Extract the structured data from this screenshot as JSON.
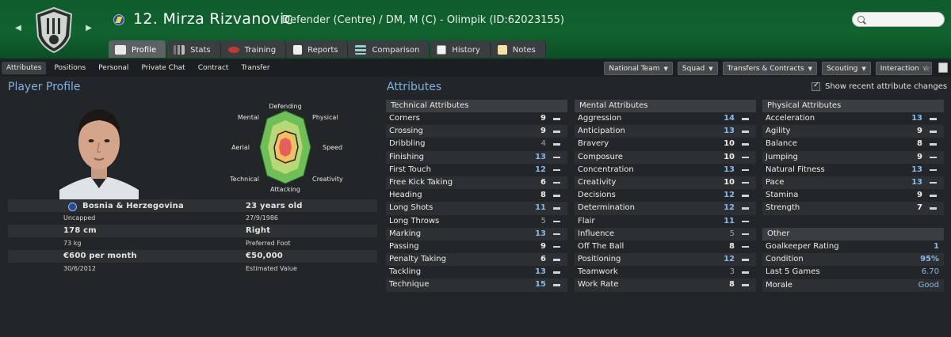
{
  "header": {
    "player_title": "12. Mirza Rizvanovic",
    "player_subtitle": "Defender (Centre) / DM, M (C) - Olimpik (ID:62023155)",
    "search_placeholder": "",
    "accent_color": "#10632f"
  },
  "tabs": [
    {
      "label": "Profile",
      "active": true
    },
    {
      "label": "Stats"
    },
    {
      "label": "Training"
    },
    {
      "label": "Reports"
    },
    {
      "label": "Comparison"
    },
    {
      "label": "History"
    },
    {
      "label": "Notes"
    }
  ],
  "subnav": {
    "links": [
      "Attributes",
      "Positions",
      "Personal",
      "Private Chat",
      "Contract",
      "Transfer"
    ],
    "buttons": [
      "National Team",
      "Squad",
      "Transfers & Contracts",
      "Scouting",
      "Interaction"
    ]
  },
  "profile": {
    "title": "Player Profile",
    "radar_labels": {
      "top": "Defending",
      "top_right": "Physical",
      "right": "Speed",
      "bottom_right": "Creativity",
      "bottom": "Attacking",
      "bottom_left": "Technical",
      "left": "Aerial",
      "top_left": "Mental"
    },
    "nationality": "Bosnia & Herzegovina",
    "caps": "Uncapped",
    "height": "178 cm",
    "weight": "73 kg",
    "wage": "€600 per month",
    "contract_end": "30/6/2012",
    "age": "23 years old",
    "dob": "27/9/1986",
    "foot": "Right",
    "foot_label": "Preferred Foot",
    "value": "€50,000",
    "value_label": "Estimated Value"
  },
  "attributes": {
    "title": "Attributes",
    "show_recent_label": "Show recent attribute changes",
    "technical": {
      "header": "Technical Attributes",
      "rows": [
        {
          "name": "Corners",
          "value": "9"
        },
        {
          "name": "Crossing",
          "value": "9"
        },
        {
          "name": "Dribbling",
          "value": "4"
        },
        {
          "name": "Finishing",
          "value": "13"
        },
        {
          "name": "First Touch",
          "value": "12"
        },
        {
          "name": "Free Kick Taking",
          "value": "6"
        },
        {
          "name": "Heading",
          "value": "8"
        },
        {
          "name": "Long Shots",
          "value": "11"
        },
        {
          "name": "Long Throws",
          "value": "5"
        },
        {
          "name": "Marking",
          "value": "13"
        },
        {
          "name": "Passing",
          "value": "9"
        },
        {
          "name": "Penalty Taking",
          "value": "6"
        },
        {
          "name": "Tackling",
          "value": "13"
        },
        {
          "name": "Technique",
          "value": "15"
        }
      ]
    },
    "mental": {
      "header": "Mental Attributes",
      "rows": [
        {
          "name": "Aggression",
          "value": "14"
        },
        {
          "name": "Anticipation",
          "value": "13"
        },
        {
          "name": "Bravery",
          "value": "10"
        },
        {
          "name": "Composure",
          "value": "10"
        },
        {
          "name": "Concentration",
          "value": "13"
        },
        {
          "name": "Creativity",
          "value": "10"
        },
        {
          "name": "Decisions",
          "value": "12"
        },
        {
          "name": "Determination",
          "value": "12"
        },
        {
          "name": "Flair",
          "value": "11"
        },
        {
          "name": "Influence",
          "value": "5"
        },
        {
          "name": "Off The Ball",
          "value": "8"
        },
        {
          "name": "Positioning",
          "value": "12"
        },
        {
          "name": "Teamwork",
          "value": "3"
        },
        {
          "name": "Work Rate",
          "value": "8"
        }
      ]
    },
    "physical": {
      "header": "Physical Attributes",
      "rows": [
        {
          "name": "Acceleration",
          "value": "13"
        },
        {
          "name": "Agility",
          "value": "9"
        },
        {
          "name": "Balance",
          "value": "8"
        },
        {
          "name": "Jumping",
          "value": "9"
        },
        {
          "name": "Natural Fitness",
          "value": "13"
        },
        {
          "name": "Pace",
          "value": "13"
        },
        {
          "name": "Stamina",
          "value": "9"
        },
        {
          "name": "Strength",
          "value": "7"
        }
      ]
    },
    "other": {
      "header": "Other",
      "rows": [
        {
          "name": "Goalkeeper Rating",
          "value": "1"
        },
        {
          "name": "Condition",
          "value": "95%"
        },
        {
          "name": "Last 5 Games",
          "value": "6.70"
        },
        {
          "name": "Morale",
          "value": "Good"
        }
      ]
    }
  }
}
